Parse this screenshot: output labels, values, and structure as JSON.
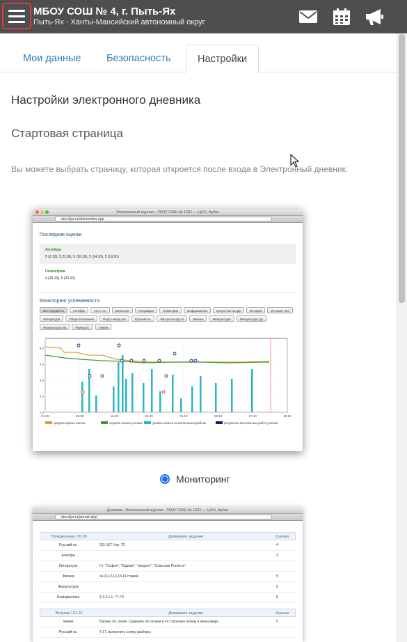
{
  "header": {
    "school_name": "МБОУ СОШ № 4, г. Пыть-Ях",
    "region": "Пыть-Ях · Ханты-Мансийский автономный округ",
    "icons": [
      "hamburger-menu-icon",
      "envelope-icon",
      "calendar-icon",
      "megaphone-icon"
    ]
  },
  "tabs": [
    {
      "label": "Мои данные",
      "active": false
    },
    {
      "label": "Безопасность",
      "active": false
    },
    {
      "label": "Настройки",
      "active": true
    }
  ],
  "settings": {
    "title": "Настройки электронного дневника",
    "subtitle": "Стартовая страница",
    "description": "Вы можете выбрать страницу, которая откроется после входа в Электронный дневник."
  },
  "option_monitoring": {
    "label": "Мониторинг",
    "selected": true,
    "preview": {
      "window_title": "Электронный журнал - ГБОУ СОШ № 1231 — ЦАО, Арбат",
      "url": "dev.eljur.ru/sitemember-app",
      "recent_grades_title": "Последние оценки",
      "subjects": [
        {
          "name": "Алгебра",
          "grades": "5 (2.10), 5 (5.10), 5 (10.10), 5 (14.10), 5 (19.10)"
        },
        {
          "name": "Геометрия",
          "grades": "4 (16.10), 5 (23.10)"
        }
      ],
      "monitoring_title": "Мониторинг успеваемости",
      "subject_buttons": [
        "Все предметы",
        "Алгебра",
        "Англ. яз.",
        "Биология",
        "География",
        "Геометрия",
        "Информатика",
        "Искусство на фр",
        "История",
        "История (нн)",
        "Литература",
        "Обществознание",
        "Подг.к межд.экз",
        "Русский яз.",
        "Физ-ра на фр.яз",
        "Физика",
        "Физкультура",
        "Физкультура (д)",
        "Физкультура (ж)",
        "Франц.яз.",
        "Химия"
      ],
      "chart_data": {
        "type": "line",
        "x_ticks": [
          "01.09",
          "09.09",
          "16.09",
          "24.09",
          "01.10",
          "09.10",
          "17.10",
          "25.10"
        ],
        "y_ticks": [
          "1.0",
          "2.0",
          "3.0",
          "4.0",
          "5.0"
        ],
        "ylim": [
          1,
          5
        ],
        "legend": [
          "средняя оценка класса",
          "средняя оценка ученика",
          "уровень класса за контрольные работы",
          "результаты контрольных работ ученика"
        ]
      }
    }
  },
  "option_diary": {
    "preview": {
      "window_title": "Дневник - Электронный журнал - ГБОУ СОШ № 1231 — ЦАО, Арбат",
      "url": "dev.eljur.ru/journal-app/",
      "day1": {
        "header": [
          "Понедельник / 30.09",
          "Домашнее задание",
          "Оценка"
        ],
        "rows": [
          [
            "Русский яз.",
            "§11-167 Упр. 72",
            "4"
          ],
          [
            "Алгебра",
            "",
            "3"
          ],
          [
            "Литература",
            "Гл. \"София\", \"Едрово\", \"медное\", \"Спасская Полесть\".",
            ""
          ],
          [
            "Физика",
            "№10,12,13,15,14 глава4",
            "5"
          ],
          [
            "Физкультура",
            "",
            "5"
          ],
          [
            "Информатика",
            "§ 3.3.1 с. 77-79",
            "5"
          ]
        ]
      },
      "day2": {
        "header": [
          "Вторник / 01.10",
          "Домашнее задание",
          "Оценка"
        ],
        "rows": [
          [
            "Химия",
            "Баланс по схеме. Сравнить по св-вам и по строению атомы и ионы меди.",
            "5"
          ],
          [
            "Русский яз.",
            "§ 17, выполнить схему разбора.",
            ""
          ]
        ]
      }
    }
  },
  "colors": {
    "topbar": "#4e4e4e",
    "link": "#337ab7",
    "radio": "#1a73e8",
    "hamburger_border": "#e23a3a"
  }
}
